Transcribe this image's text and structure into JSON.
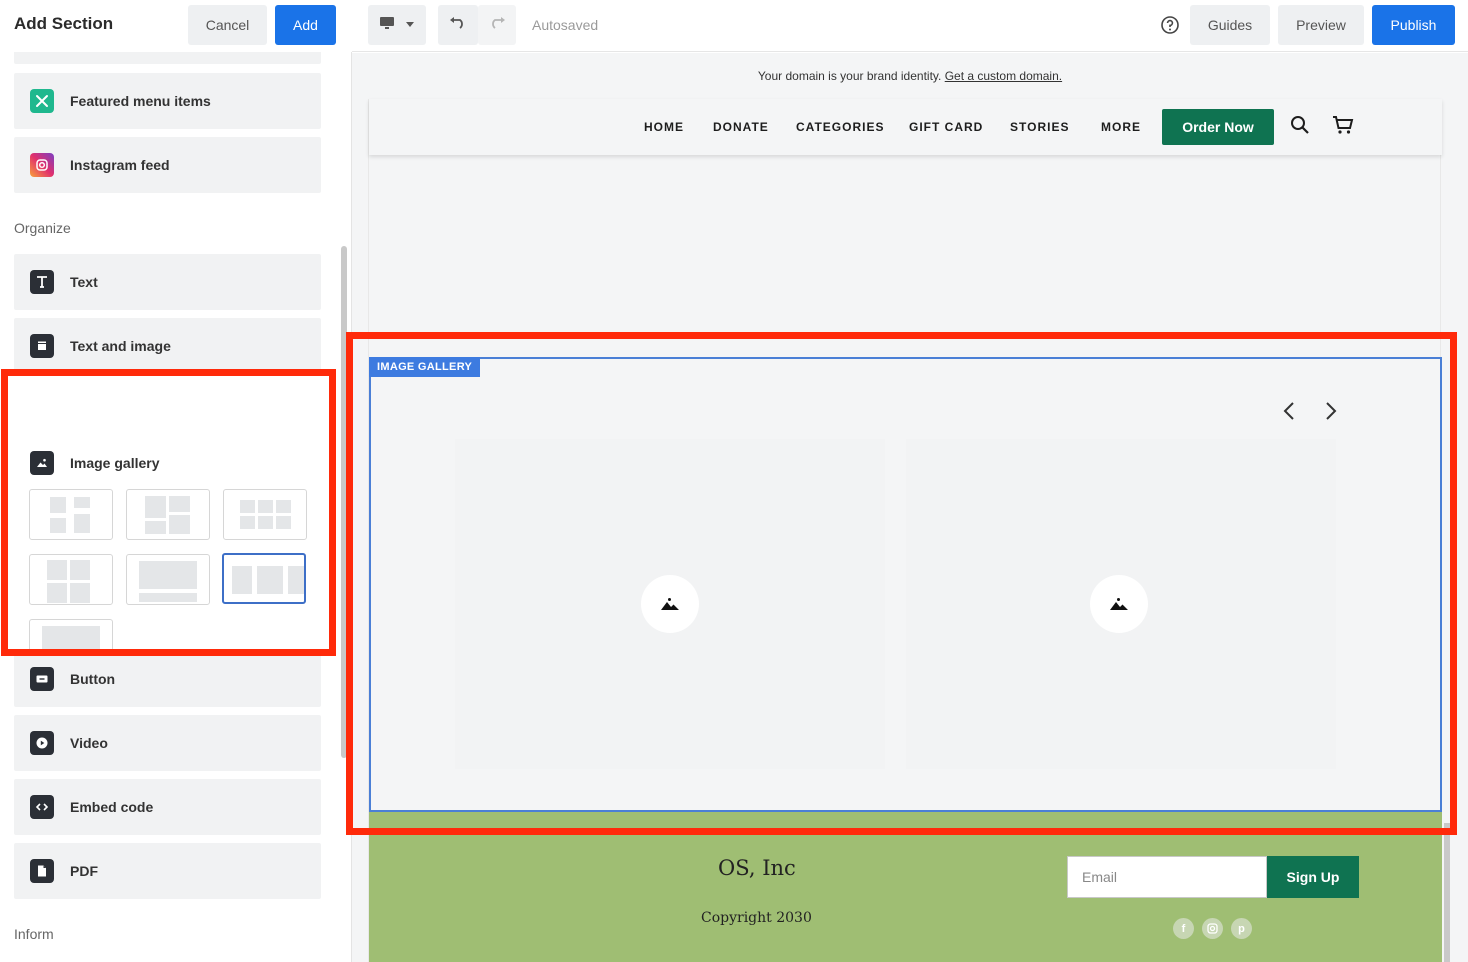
{
  "left_panel": {
    "title": "Add Section",
    "cancel_label": "Cancel",
    "add_label": "Add",
    "items_top": [
      {
        "label": "Featured menu items",
        "icon": "fork-knife-icon"
      },
      {
        "label": "Instagram feed",
        "icon": "instagram-icon"
      }
    ],
    "organize_label": "Organize",
    "organize_items": [
      {
        "label": "Text",
        "icon": "text-icon"
      },
      {
        "label": "Text and image",
        "icon": "text-image-icon"
      },
      {
        "label": "Image gallery",
        "icon": "image-icon"
      },
      {
        "label": "Button",
        "icon": "button-icon"
      },
      {
        "label": "Video",
        "icon": "play-icon"
      },
      {
        "label": "Embed code",
        "icon": "code-icon"
      },
      {
        "label": "PDF",
        "icon": "document-icon"
      }
    ],
    "inform_label": "Inform",
    "gallery_layouts_selected_index": 5
  },
  "toolbar": {
    "autosaved": "Autosaved",
    "guides_label": "Guides",
    "preview_label": "Preview",
    "publish_label": "Publish"
  },
  "canvas": {
    "domain_note": "Your domain is your brand identity.",
    "domain_link": "Get a custom domain.",
    "nav_links": [
      "HOME",
      "DONATE",
      "CATEGORIES",
      "GIFT CARD",
      "STORIES",
      "MORE"
    ],
    "order_button": "Order Now",
    "gallery_badge": "IMAGE GALLERY",
    "footer": {
      "company": "OS, Inc",
      "copyright": "Copyright 2030",
      "email_placeholder": "Email",
      "signup_label": "Sign Up"
    }
  },
  "colors": {
    "accent": "#1a73e8",
    "brand_green": "#0f7351",
    "footer_bg": "#9fbe73",
    "highlight": "#ff2a0a"
  }
}
